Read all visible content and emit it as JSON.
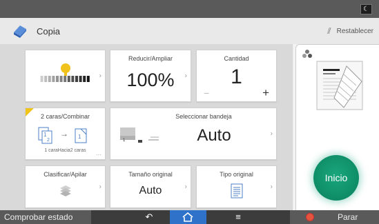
{
  "header": {
    "app_title": "Copia",
    "reset_label": "Restablecer",
    "moon_icon": "moon-icon",
    "app_icon": "copy-app-icon"
  },
  "tiles": {
    "density": {
      "level_fraction": 0.5
    },
    "reduce_enlarge": {
      "title": "Reducir/Ampliar",
      "value": "100%"
    },
    "quantity": {
      "title": "Cantidad",
      "value": "1",
      "minus": "−",
      "plus": "+"
    },
    "duplex": {
      "title": "2 caras/Combinar",
      "caption": "1 caraHacia2 caras",
      "arrow": "→"
    },
    "tray": {
      "title": "Seleccionar bandeja",
      "value": "Auto"
    },
    "sort": {
      "title": "Clasificar/Apilar"
    },
    "orig_size": {
      "title": "Tamaño original",
      "value": "Auto"
    },
    "orig_type": {
      "title": "Tipo original"
    }
  },
  "right_panel": {
    "start_label": "Inicio"
  },
  "bottom_bar": {
    "status_label": "Comprobar estado",
    "back_glyph": "↶",
    "menu_glyph": "≡",
    "stop_label": "Parar"
  },
  "colors": {
    "accent_green": "#0e8c66",
    "home_blue": "#2e73c9",
    "flag_yellow": "#f0c419",
    "stop_red": "#e5553d"
  }
}
